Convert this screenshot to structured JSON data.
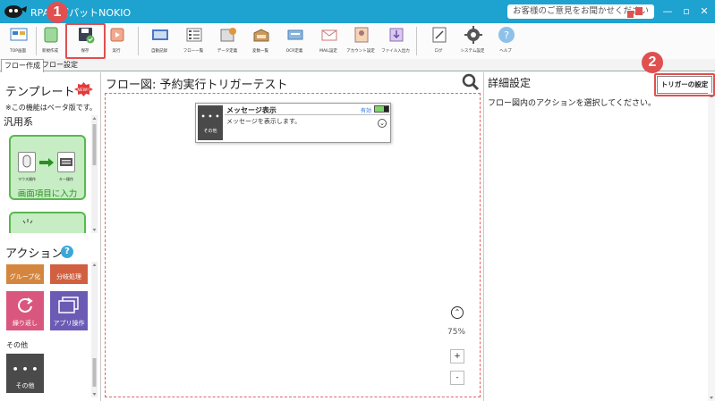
{
  "titlebar": {
    "app_title": "RPAロボパットNOKIO",
    "feedback": "お客様のご意見をお聞かせください",
    "minimize": "—",
    "restore": "▫",
    "close": "✕",
    "bg_color": "#1ea2cf"
  },
  "ribbon": {
    "buttons": [
      {
        "label": "TOP画面",
        "icon": "top-screen-icon"
      },
      {
        "label": "新規作成",
        "icon": "new-icon"
      },
      {
        "label": "保存",
        "icon": "save-icon"
      },
      {
        "label": "実行",
        "icon": "run-icon"
      },
      {
        "label": "自動記録",
        "icon": "record-icon"
      },
      {
        "label": "フロー一覧",
        "icon": "flow-list-icon"
      },
      {
        "label": "データ定義",
        "icon": "data-def-icon"
      },
      {
        "label": "変数一覧",
        "icon": "variable-icon"
      },
      {
        "label": "OCR定義",
        "icon": "ocr-icon"
      },
      {
        "label": "MAIL設定",
        "icon": "mail-icon"
      },
      {
        "label": "アカウント設定",
        "icon": "account-icon"
      },
      {
        "label": "ファイル入出力",
        "icon": "file-io-icon"
      },
      {
        "label": "ログ",
        "icon": "log-icon"
      },
      {
        "label": "システム設定",
        "icon": "gear-icon"
      },
      {
        "label": "ヘルプ",
        "icon": "help-icon"
      }
    ]
  },
  "tabs": [
    "フロー作成",
    "フロー設定"
  ],
  "templates": {
    "title": "テンプレート",
    "badge": "NEW!!",
    "note": "※この機能はベータ版です。",
    "category": "汎用系",
    "card": {
      "label1": "マウス操作",
      "label2": "キー操作",
      "name": "画面項目に入力"
    }
  },
  "actions": {
    "title": "アクション",
    "help": "?",
    "tiles": [
      {
        "name": "グループ化",
        "color": "#d4863f"
      },
      {
        "name": "分岐処理",
        "color": "#d06040"
      },
      {
        "name": "繰り返し",
        "color": "#d9577f"
      },
      {
        "name": "アプリ操作",
        "color": "#6b5bb5"
      }
    ],
    "sub_category": "その他",
    "other_tile": {
      "name": "その他",
      "color": "#4a4a4a",
      "dots": "• • •"
    }
  },
  "flow": {
    "title": "フロー図:  予約実行トリガーテスト",
    "node": {
      "title": "メッセージ表示",
      "description": "メッセージを表示します。",
      "valid": "有効",
      "icon_label": "その他",
      "dots": "• • •"
    },
    "zoom": "75%",
    "zoom_in": "+",
    "zoom_out": "-"
  },
  "detail": {
    "title": "詳細設定",
    "trigger_button": "トリガーの設定",
    "message": "フロー図内のアクションを選択してください。"
  },
  "callouts": [
    "1",
    "2"
  ],
  "colors": {
    "accent": "#1ea2cf",
    "highlight": "#e05050",
    "template_green": "#58b84f"
  }
}
